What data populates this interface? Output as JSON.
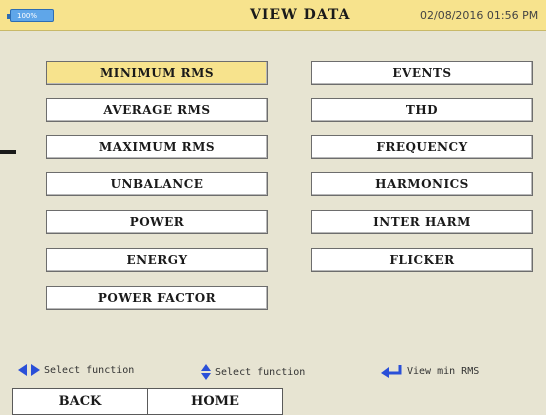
{
  "header": {
    "battery_label": "100%",
    "title": "VIEW DATA",
    "datetime": "02/08/2016 01:56 PM"
  },
  "functions_left": [
    {
      "label": "MINIMUM RMS",
      "selected": true
    },
    {
      "label": "AVERAGE RMS"
    },
    {
      "label": "MAXIMUM RMS"
    },
    {
      "label": "UNBALANCE"
    },
    {
      "label": "POWER"
    },
    {
      "label": "ENERGY"
    },
    {
      "label": "POWER FACTOR"
    }
  ],
  "functions_right": [
    {
      "label": "EVENTS"
    },
    {
      "label": "THD"
    },
    {
      "label": "FREQUENCY"
    },
    {
      "label": "HARMONICS"
    },
    {
      "label": "INTER HARM"
    },
    {
      "label": "FLICKER"
    }
  ],
  "hints": {
    "left_right": "Select function",
    "up_down": "Select function",
    "enter": "View min RMS"
  },
  "footer": {
    "back_label": "BACK",
    "home_label": "HOME"
  },
  "colors": {
    "background": "#e7e4d2",
    "header": "#f7e38d",
    "selected": "#f7e38d",
    "icon_blue": "#2a4fd8"
  }
}
